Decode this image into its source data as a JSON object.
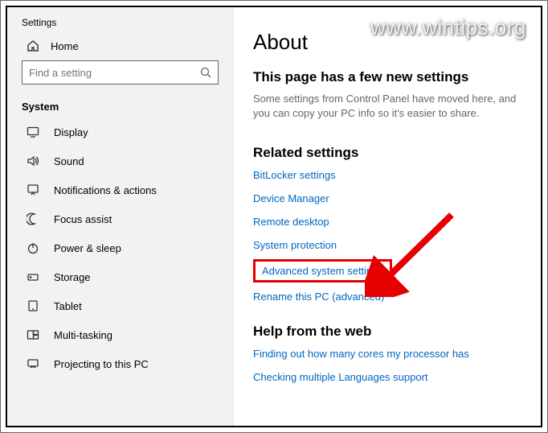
{
  "sidebar": {
    "app_title": "Settings",
    "home_label": "Home",
    "search_placeholder": "Find a setting",
    "section_label": "System",
    "items": [
      {
        "label": "Display"
      },
      {
        "label": "Sound"
      },
      {
        "label": "Notifications & actions"
      },
      {
        "label": "Focus assist"
      },
      {
        "label": "Power & sleep"
      },
      {
        "label": "Storage"
      },
      {
        "label": "Tablet"
      },
      {
        "label": "Multi-tasking"
      },
      {
        "label": "Projecting to this PC"
      }
    ]
  },
  "content": {
    "title": "About",
    "sub_title": "This page has a few new settings",
    "sub_body": "Some settings from Control Panel have moved here, and you can copy your PC info so it's easier to share.",
    "related_title": "Related settings",
    "related_links": [
      "BitLocker settings",
      "Device Manager",
      "Remote desktop",
      "System protection",
      "Advanced system settings",
      "Rename this PC (advanced)"
    ],
    "help_title": "Help from the web",
    "help_links": [
      "Finding out how many cores my processor has",
      "Checking multiple Languages support"
    ]
  },
  "watermark": "www.wintips.org",
  "annotations": {
    "highlighted_link_index": 4,
    "highlight_color": "#e60000",
    "arrow_color": "#e60000"
  }
}
